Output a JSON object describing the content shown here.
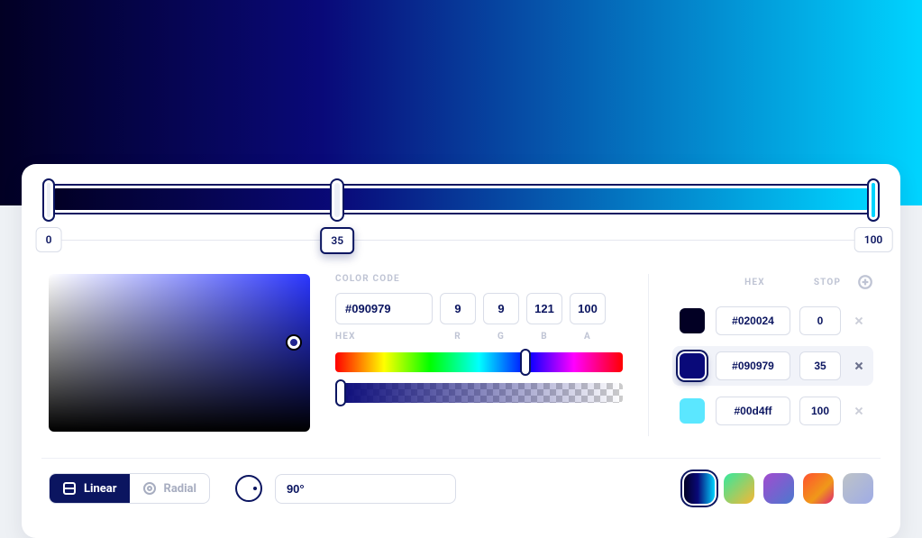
{
  "stops": [
    {
      "hex": "#020024",
      "pos": "0"
    },
    {
      "hex": "#090979",
      "pos": "35"
    },
    {
      "hex": "#00d4ff",
      "pos": "100"
    }
  ],
  "selected_stop_index": 1,
  "scale": {
    "min": "0",
    "sel": "35",
    "max": "100"
  },
  "code": {
    "title": "COLOR CODE",
    "hex": "#090979",
    "r": "9",
    "g": "9",
    "b": "121",
    "a": "100",
    "labels": {
      "hex": "HEX",
      "r": "R",
      "g": "G",
      "b": "B",
      "a": "A"
    }
  },
  "stops_list": {
    "hex_label": "HEX",
    "stop_label": "STOP"
  },
  "type": {
    "linear": "Linear",
    "radial": "Radial",
    "active": "linear"
  },
  "angle": "90°"
}
